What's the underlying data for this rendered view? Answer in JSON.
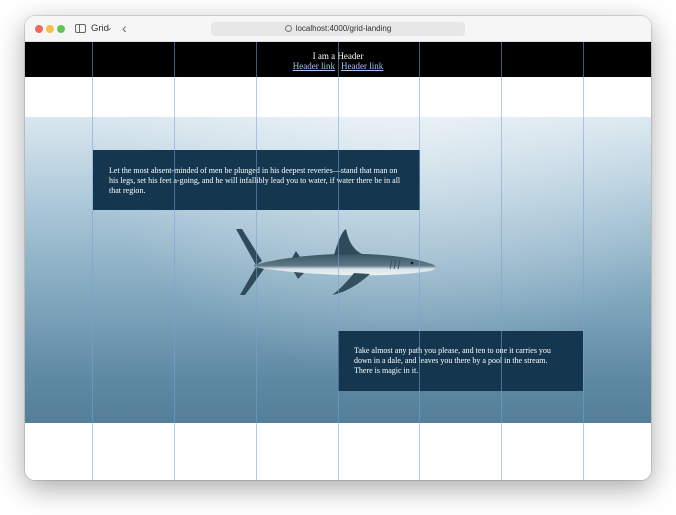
{
  "browser": {
    "tab_label": "Grid",
    "url": "localhost:4000/grid-landing",
    "icons": [
      "close-light",
      "minimize-light",
      "zoom-light",
      "sidebar-icon",
      "chevron-down-icon",
      "back-arrow-icon",
      "globe-icon"
    ],
    "colors": {
      "close": "#ed6a5e",
      "minimize": "#f5bf4f",
      "zoom": "#61c554"
    }
  },
  "header": {
    "title": "I am a Header",
    "links": [
      "Header link",
      "Header link"
    ],
    "background": "#000000"
  },
  "hero": {
    "image": "shark-swimming-underwater",
    "box_color": "#14374f",
    "text_1": "Let the most absent-minded of men be plunged in his deepest reveries—stand that man on his legs, set his feet a-going, and he will infallibly lead you to water, if water there be in all that region.",
    "text_2": "Take almost any path you please, and ten to one it carries you down in a dale, and leaves you there by a pool in the stream. There is magic in it."
  },
  "grid_overlay": {
    "columns": 8,
    "line_color": "#78a0dc"
  }
}
